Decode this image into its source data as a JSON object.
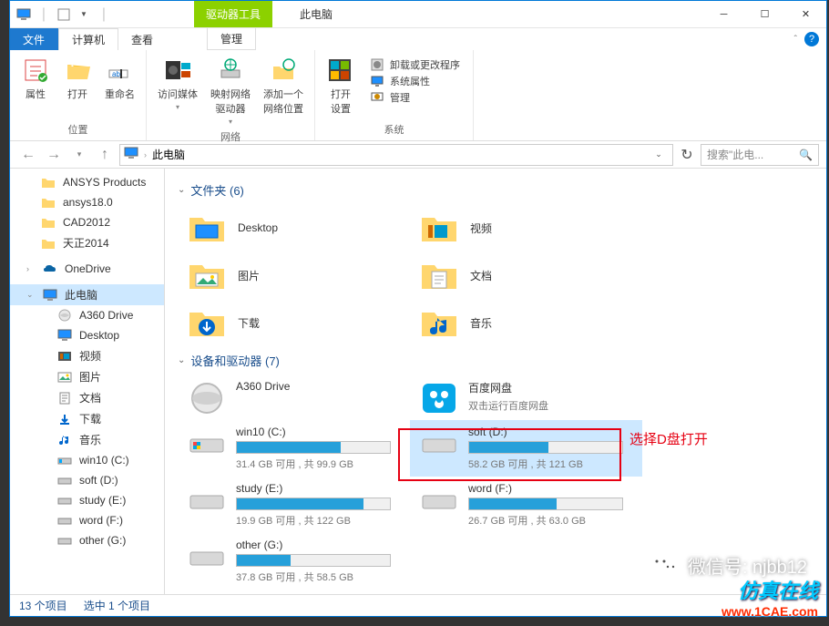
{
  "window": {
    "tool_tab_label": "驱动器工具",
    "tool_tab_sub": "管理",
    "title": "此电脑",
    "menu": {
      "file": "文件",
      "computer": "计算机",
      "view": "查看"
    }
  },
  "ribbon": {
    "location": {
      "properties": "属性",
      "open": "打开",
      "rename": "重命名",
      "group": "位置"
    },
    "network": {
      "media": "访问媒体",
      "map": "映射网络\n驱动器",
      "addloc": "添加一个\n网络位置",
      "group": "网络"
    },
    "system": {
      "open_settings": "打开\n设置",
      "uninstall": "卸载或更改程序",
      "sysprop": "系统属性",
      "manage": "管理",
      "group": "系统"
    }
  },
  "addrbar": {
    "crumb": "此电脑",
    "search_placeholder": "搜索\"此电..."
  },
  "nav": {
    "ansys_products": "ANSYS Products",
    "ansys18": "ansys18.0",
    "cad2012": "CAD2012",
    "tianzheng": "天正2014",
    "onedrive": "OneDrive",
    "thispc": "此电脑",
    "a360": "A360 Drive",
    "desktop": "Desktop",
    "videos": "视频",
    "pictures": "图片",
    "documents": "文档",
    "downloads": "下载",
    "music": "音乐",
    "win10c": "win10 (C:)",
    "softd": "soft (D:)",
    "studye": "study (E:)",
    "wordf": "word (F:)",
    "otherg": "other (G:)"
  },
  "sections": {
    "folders": "文件夹 (6)",
    "drives": "设备和驱动器 (7)"
  },
  "folders": {
    "desktop": "Desktop",
    "videos": "视频",
    "pictures": "图片",
    "documents": "文档",
    "downloads": "下载",
    "music": "音乐"
  },
  "drives": {
    "a360": {
      "name": "A360 Drive"
    },
    "baidu": {
      "name": "百度网盘",
      "sub": "双击运行百度网盘"
    },
    "c": {
      "name": "win10 (C:)",
      "stat": "31.4 GB 可用 , 共 99.9 GB",
      "pct": 68
    },
    "d": {
      "name": "soft (D:)",
      "stat": "58.2 GB 可用 , 共 121 GB",
      "pct": 52
    },
    "e": {
      "name": "study (E:)",
      "stat": "19.9 GB 可用 , 共 122 GB",
      "pct": 83
    },
    "f": {
      "name": "word (F:)",
      "stat": "26.7 GB 可用 , 共 63.0 GB",
      "pct": 57
    },
    "g": {
      "name": "other (G:)",
      "stat": "37.8 GB 可用 , 共 58.5 GB",
      "pct": 35
    }
  },
  "annotation": {
    "select_d": "选择D盘打开"
  },
  "statusbar": {
    "count": "13 个项目",
    "selected": "选中 1 个项目"
  },
  "overlay": {
    "wechat": "微信号: njbb12",
    "brand1": "仿真在线",
    "brand2": "www.1CAE.com"
  }
}
